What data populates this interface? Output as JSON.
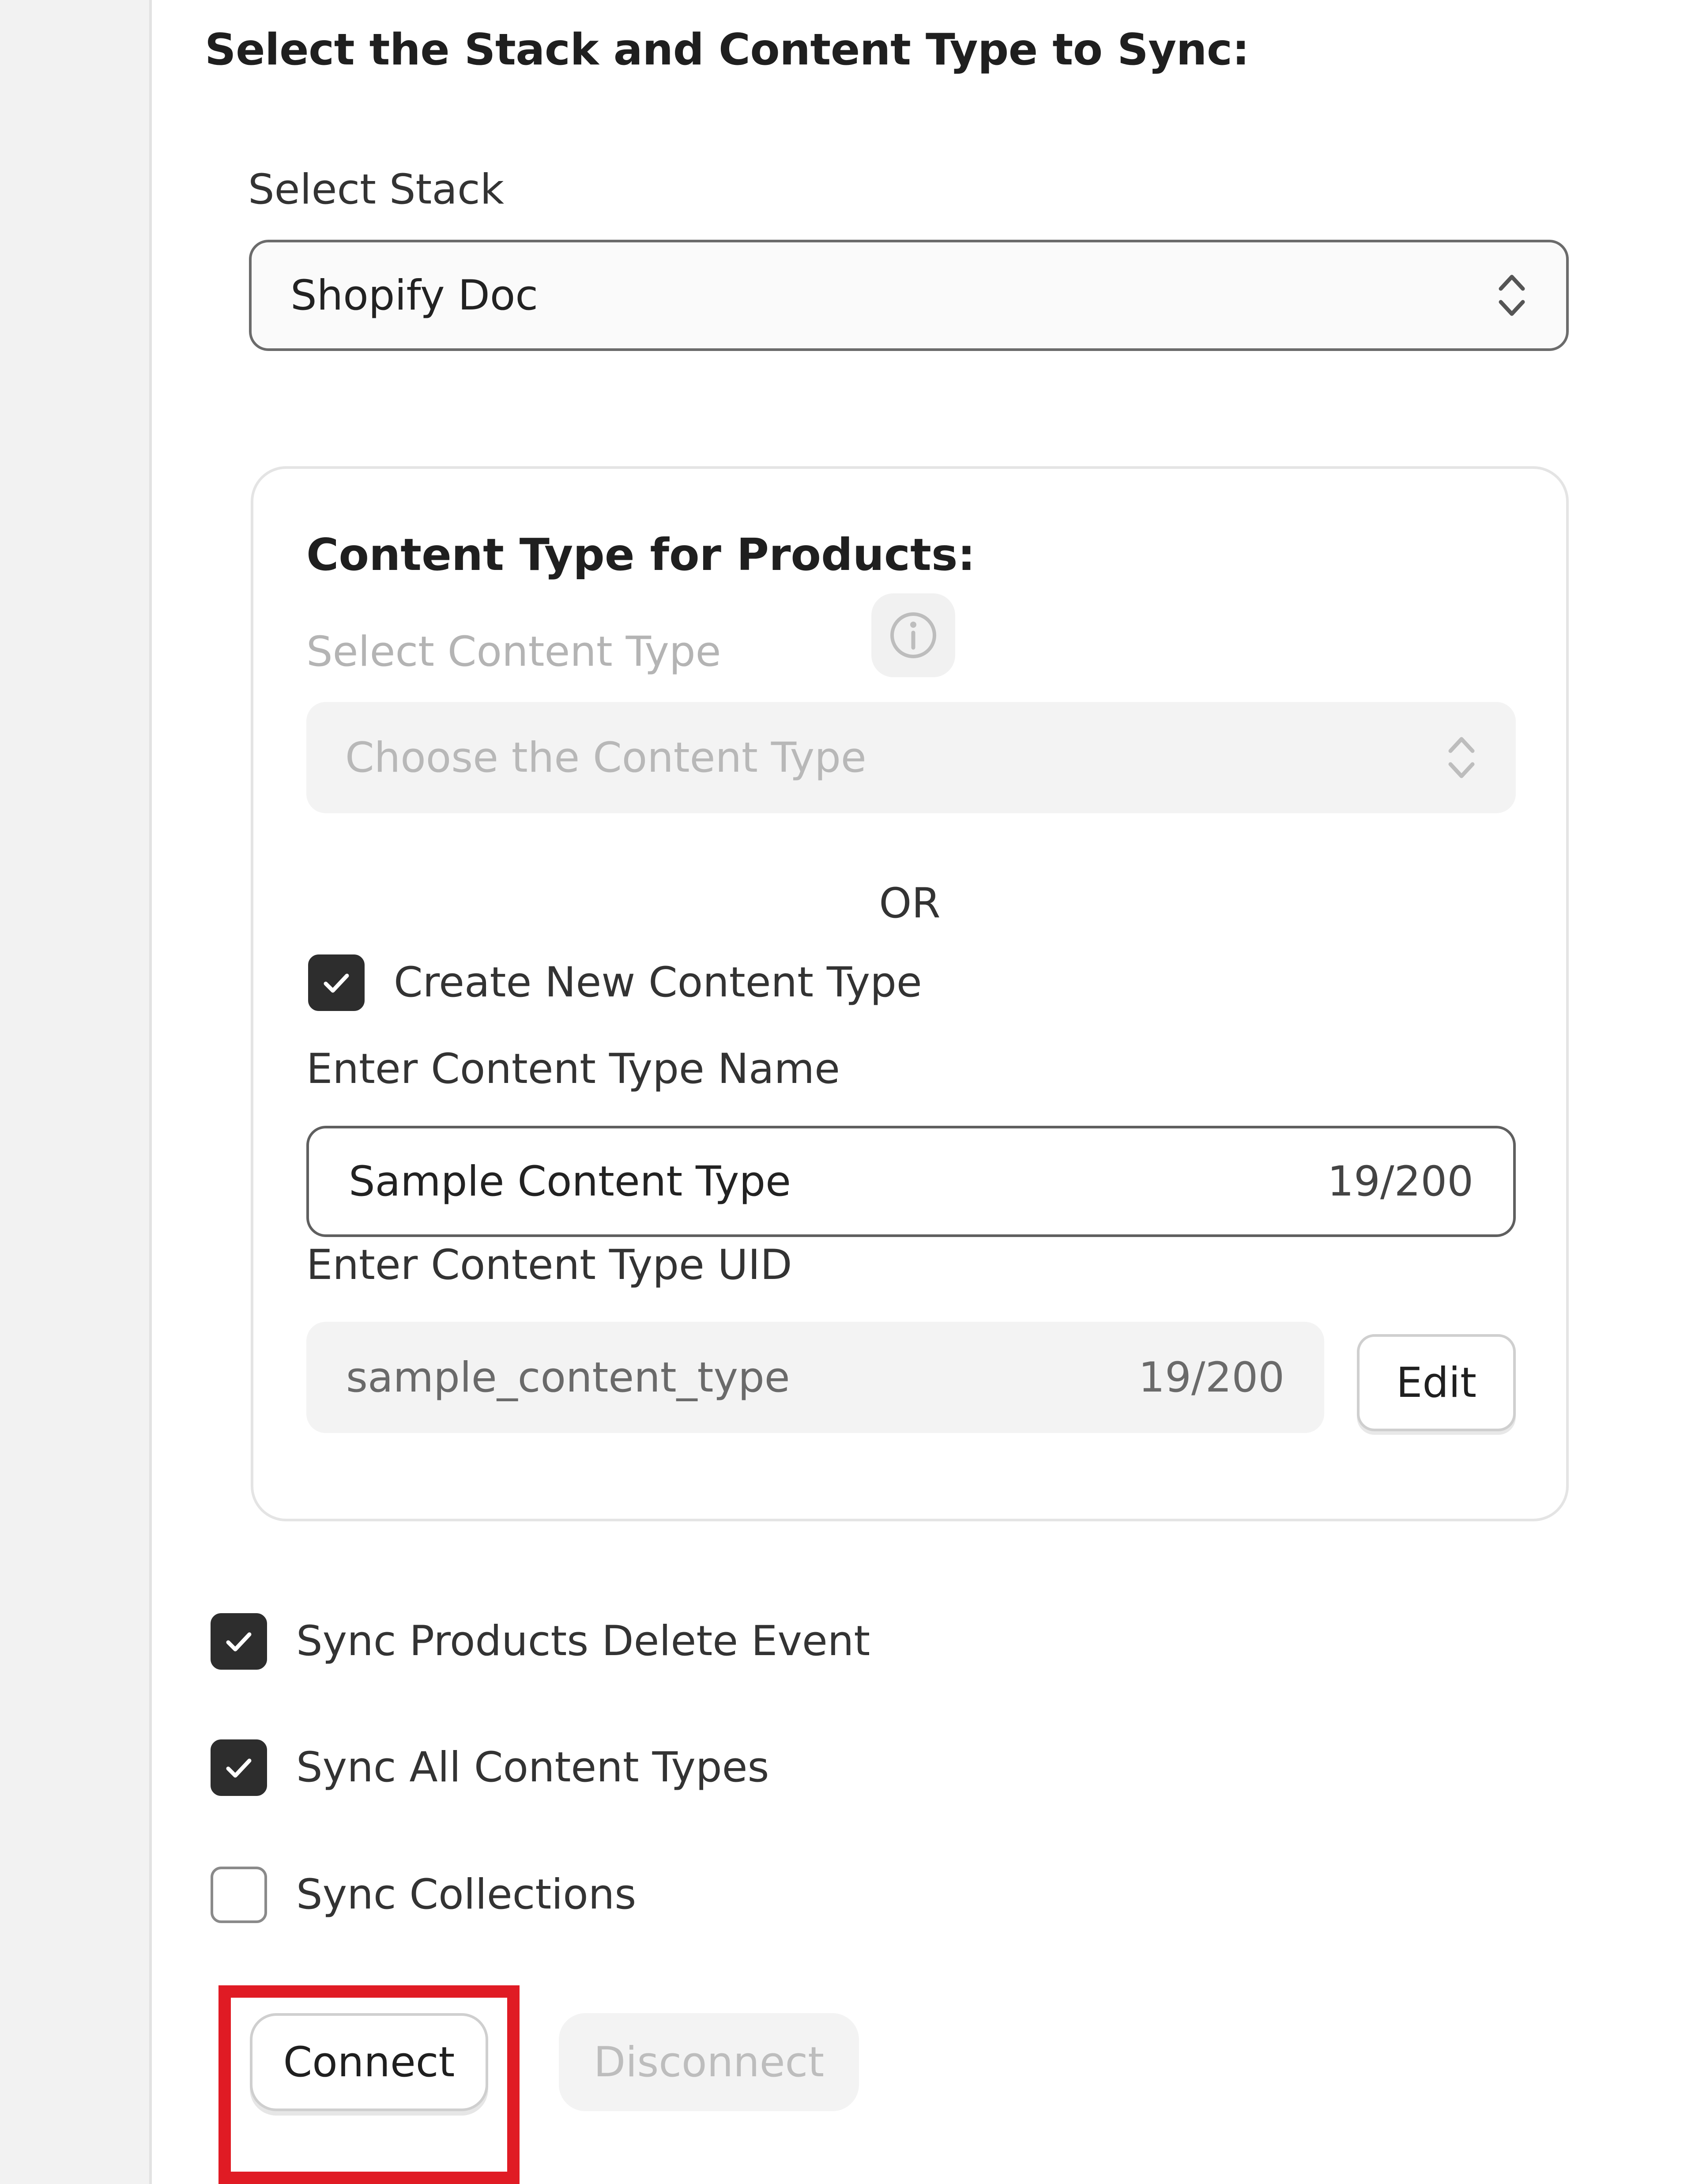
{
  "section": {
    "title": "Select the Stack and Content Type to Sync:"
  },
  "stack": {
    "label": "Select Stack",
    "selected": "Shopify Doc",
    "icon": "chevron-up-down-icon"
  },
  "products_card": {
    "title": "Content Type for Products:",
    "select_label": "Select Content Type",
    "info_icon": "info-icon",
    "select_placeholder": "Choose the Content Type",
    "or_text": "OR",
    "create_new": {
      "label": "Create New Content Type",
      "checked": true
    },
    "name": {
      "label": "Enter Content Type Name",
      "value": "Sample Content Type",
      "counter": "19/200"
    },
    "uid": {
      "label": "Enter Content Type UID",
      "value": "sample_content_type",
      "counter": "19/200",
      "edit_label": "Edit"
    }
  },
  "options": [
    {
      "label": "Sync Products Delete Event",
      "checked": true
    },
    {
      "label": "Sync All Content Types",
      "checked": true
    },
    {
      "label": "Sync Collections",
      "checked": false
    }
  ],
  "actions": {
    "connect_label": "Connect",
    "disconnect_label": "Disconnect"
  },
  "colors": {
    "highlight": "#e01b24",
    "checkbox_checked": "#2d2d2d",
    "disabled_text": "#b8b8b8"
  }
}
